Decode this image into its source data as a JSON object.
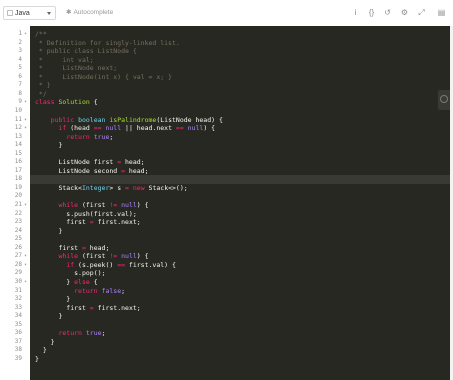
{
  "toolbar": {
    "language": "Java",
    "autocomplete_label": "Autocomplete",
    "icons": [
      "info-icon",
      "braces-icon",
      "reset-icon",
      "settings-icon",
      "fullscreen-icon",
      "menu-icon"
    ]
  },
  "colors": {
    "background": "#272822",
    "comment": "#75715e",
    "keyword": "#f92672",
    "type": "#66d9ef",
    "literal": "#ae81ff",
    "function": "#a6e22e",
    "text": "#f8f8f2"
  },
  "editor": {
    "active_line": 18,
    "lines": [
      {
        "n": "1",
        "fold": "▾",
        "tokens": [
          {
            "c": "c",
            "t": "/**"
          }
        ]
      },
      {
        "n": "2",
        "fold": "",
        "tokens": [
          {
            "c": "c",
            "t": " * Definition for singly-linked list."
          }
        ]
      },
      {
        "n": "3",
        "fold": "",
        "tokens": [
          {
            "c": "c",
            "t": " * public class ListNode {"
          }
        ]
      },
      {
        "n": "4",
        "fold": "",
        "tokens": [
          {
            "c": "c",
            "t": " *     int val;"
          }
        ]
      },
      {
        "n": "5",
        "fold": "",
        "tokens": [
          {
            "c": "c",
            "t": " *     ListNode next;"
          }
        ]
      },
      {
        "n": "6",
        "fold": "",
        "tokens": [
          {
            "c": "c",
            "t": " *     ListNode(int x) { val = x; }"
          }
        ]
      },
      {
        "n": "7",
        "fold": "",
        "tokens": [
          {
            "c": "c",
            "t": " * }"
          }
        ]
      },
      {
        "n": "8",
        "fold": "",
        "tokens": [
          {
            "c": "c",
            "t": " */"
          }
        ]
      },
      {
        "n": "9",
        "fold": "▾",
        "tokens": [
          {
            "c": "k",
            "t": "class "
          },
          {
            "c": "f",
            "t": "Solution"
          },
          {
            "c": "p",
            "t": " {"
          }
        ]
      },
      {
        "n": "10",
        "fold": "",
        "tokens": []
      },
      {
        "n": "11",
        "fold": "▾",
        "tokens": [
          {
            "c": "p",
            "t": "    "
          },
          {
            "c": "k",
            "t": "public "
          },
          {
            "c": "t",
            "t": "boolean "
          },
          {
            "c": "f",
            "t": "isPalindrome"
          },
          {
            "c": "p",
            "t": "(ListNode head) {"
          }
        ]
      },
      {
        "n": "12",
        "fold": "▾",
        "tokens": [
          {
            "c": "p",
            "t": "      "
          },
          {
            "c": "k",
            "t": "if"
          },
          {
            "c": "p",
            "t": " (head "
          },
          {
            "c": "k",
            "t": "=="
          },
          {
            "c": "p",
            "t": " "
          },
          {
            "c": "v",
            "t": "null"
          },
          {
            "c": "p",
            "t": " || head.next "
          },
          {
            "c": "k",
            "t": "=="
          },
          {
            "c": "p",
            "t": " "
          },
          {
            "c": "v",
            "t": "null"
          },
          {
            "c": "p",
            "t": ") {"
          }
        ]
      },
      {
        "n": "13",
        "fold": "",
        "tokens": [
          {
            "c": "p",
            "t": "        "
          },
          {
            "c": "k",
            "t": "return "
          },
          {
            "c": "v",
            "t": "true"
          },
          {
            "c": "p",
            "t": ";"
          }
        ]
      },
      {
        "n": "14",
        "fold": "",
        "tokens": [
          {
            "c": "p",
            "t": "      }"
          }
        ]
      },
      {
        "n": "15",
        "fold": "",
        "tokens": []
      },
      {
        "n": "16",
        "fold": "",
        "tokens": [
          {
            "c": "p",
            "t": "      ListNode first "
          },
          {
            "c": "k",
            "t": "="
          },
          {
            "c": "p",
            "t": " head;"
          }
        ]
      },
      {
        "n": "17",
        "fold": "",
        "tokens": [
          {
            "c": "p",
            "t": "      ListNode second "
          },
          {
            "c": "k",
            "t": "="
          },
          {
            "c": "p",
            "t": " head;"
          }
        ]
      },
      {
        "n": "18",
        "fold": "",
        "tokens": []
      },
      {
        "n": "19",
        "fold": "",
        "tokens": [
          {
            "c": "p",
            "t": "      Stack<"
          },
          {
            "c": "t",
            "t": "Integer"
          },
          {
            "c": "p",
            "t": "> s "
          },
          {
            "c": "k",
            "t": "="
          },
          {
            "c": "p",
            "t": " "
          },
          {
            "c": "k",
            "t": "new"
          },
          {
            "c": "p",
            "t": " Stack<>();"
          }
        ]
      },
      {
        "n": "20",
        "fold": "",
        "tokens": []
      },
      {
        "n": "21",
        "fold": "▾",
        "tokens": [
          {
            "c": "p",
            "t": "      "
          },
          {
            "c": "k",
            "t": "while"
          },
          {
            "c": "p",
            "t": " (first "
          },
          {
            "c": "k",
            "t": "!="
          },
          {
            "c": "p",
            "t": " "
          },
          {
            "c": "v",
            "t": "null"
          },
          {
            "c": "p",
            "t": ") {"
          }
        ]
      },
      {
        "n": "22",
        "fold": "",
        "tokens": [
          {
            "c": "p",
            "t": "        s.push(first.val);"
          }
        ]
      },
      {
        "n": "23",
        "fold": "",
        "tokens": [
          {
            "c": "p",
            "t": "        first "
          },
          {
            "c": "k",
            "t": "="
          },
          {
            "c": "p",
            "t": " first.next;"
          }
        ]
      },
      {
        "n": "24",
        "fold": "",
        "tokens": [
          {
            "c": "p",
            "t": "      }"
          }
        ]
      },
      {
        "n": "25",
        "fold": "",
        "tokens": []
      },
      {
        "n": "26",
        "fold": "",
        "tokens": [
          {
            "c": "p",
            "t": "      first "
          },
          {
            "c": "k",
            "t": "="
          },
          {
            "c": "p",
            "t": " head;"
          }
        ]
      },
      {
        "n": "27",
        "fold": "▾",
        "tokens": [
          {
            "c": "p",
            "t": "      "
          },
          {
            "c": "k",
            "t": "while"
          },
          {
            "c": "p",
            "t": " (first "
          },
          {
            "c": "k",
            "t": "!="
          },
          {
            "c": "p",
            "t": " "
          },
          {
            "c": "v",
            "t": "null"
          },
          {
            "c": "p",
            "t": ") {"
          }
        ]
      },
      {
        "n": "28",
        "fold": "▾",
        "tokens": [
          {
            "c": "p",
            "t": "        "
          },
          {
            "c": "k",
            "t": "if"
          },
          {
            "c": "p",
            "t": " (s.peek() "
          },
          {
            "c": "k",
            "t": "=="
          },
          {
            "c": "p",
            "t": " first.val) {"
          }
        ]
      },
      {
        "n": "29",
        "fold": "",
        "tokens": [
          {
            "c": "p",
            "t": "          s.pop();"
          }
        ]
      },
      {
        "n": "30",
        "fold": "▾",
        "tokens": [
          {
            "c": "p",
            "t": "        } "
          },
          {
            "c": "k",
            "t": "else"
          },
          {
            "c": "p",
            "t": " {"
          }
        ]
      },
      {
        "n": "31",
        "fold": "",
        "tokens": [
          {
            "c": "p",
            "t": "          "
          },
          {
            "c": "k",
            "t": "return "
          },
          {
            "c": "v",
            "t": "false"
          },
          {
            "c": "p",
            "t": ";"
          }
        ]
      },
      {
        "n": "32",
        "fold": "",
        "tokens": [
          {
            "c": "p",
            "t": "        }"
          }
        ]
      },
      {
        "n": "33",
        "fold": "",
        "tokens": [
          {
            "c": "p",
            "t": "        first "
          },
          {
            "c": "k",
            "t": "="
          },
          {
            "c": "p",
            "t": " first.next;"
          }
        ]
      },
      {
        "n": "34",
        "fold": "",
        "tokens": [
          {
            "c": "p",
            "t": "      }"
          }
        ]
      },
      {
        "n": "35",
        "fold": "",
        "tokens": []
      },
      {
        "n": "36",
        "fold": "",
        "tokens": [
          {
            "c": "p",
            "t": "      "
          },
          {
            "c": "k",
            "t": "return "
          },
          {
            "c": "v",
            "t": "true"
          },
          {
            "c": "p",
            "t": ";"
          }
        ]
      },
      {
        "n": "37",
        "fold": "",
        "tokens": [
          {
            "c": "p",
            "t": "    }"
          }
        ]
      },
      {
        "n": "38",
        "fold": "",
        "tokens": [
          {
            "c": "p",
            "t": "  }"
          }
        ]
      },
      {
        "n": "39",
        "fold": "",
        "tokens": [
          {
            "c": "p",
            "t": "}"
          }
        ]
      }
    ]
  }
}
